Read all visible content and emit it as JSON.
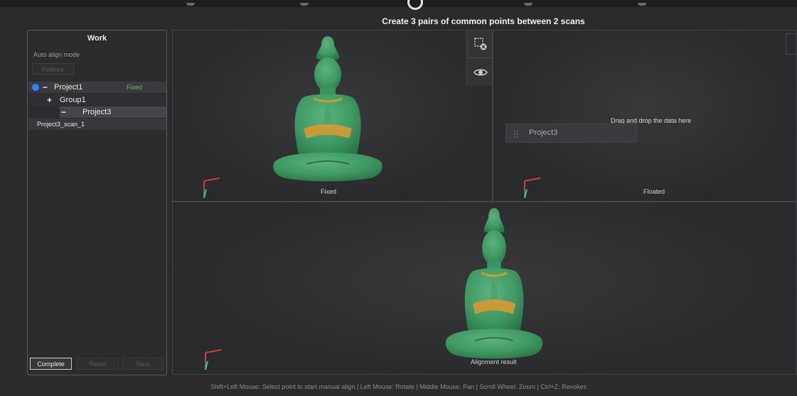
{
  "top": {
    "instruction": "Create 3 pairs of common points between 2 scans"
  },
  "work_panel": {
    "title": "Work",
    "mode_label": "Auto align mode",
    "feature_button": "Feature",
    "tree": {
      "project1": {
        "toggle": "−",
        "label": "Project1",
        "tag": "Fixed"
      },
      "group1": {
        "toggle": "+",
        "label": "Group1"
      },
      "project3": {
        "toggle": "−",
        "label": "Project3"
      },
      "scan": {
        "label": "Project3_scan_1"
      }
    },
    "buttons": {
      "complete": "Complete",
      "reset": "Reset",
      "next": "Next"
    }
  },
  "viewports": {
    "fixed": {
      "label": "Fixed"
    },
    "floated": {
      "label": "Floated",
      "drop_hint": "Drag and drop the data here",
      "drag_item": "Project3"
    },
    "result": {
      "label": "Alignment result"
    }
  },
  "icons": {
    "tools": [
      "remove-selection-icon",
      "eye-icon"
    ],
    "axes": "axis-triad-icon",
    "drag": "drag-handle-icon"
  },
  "colors": {
    "background": "#2b2b2d",
    "model_green": "#3f9a63",
    "model_highlight": "#c99a3a",
    "fixed_tag": "#62c062",
    "info_blue": "#2f7fff"
  },
  "status_bar": "Shift+Left Mouse: Select point to start manual align | Left Mouse: Rotate | Middle Mouse: Pan | Scroll Wheel: Zoom | Ctrl+Z: Revokes"
}
